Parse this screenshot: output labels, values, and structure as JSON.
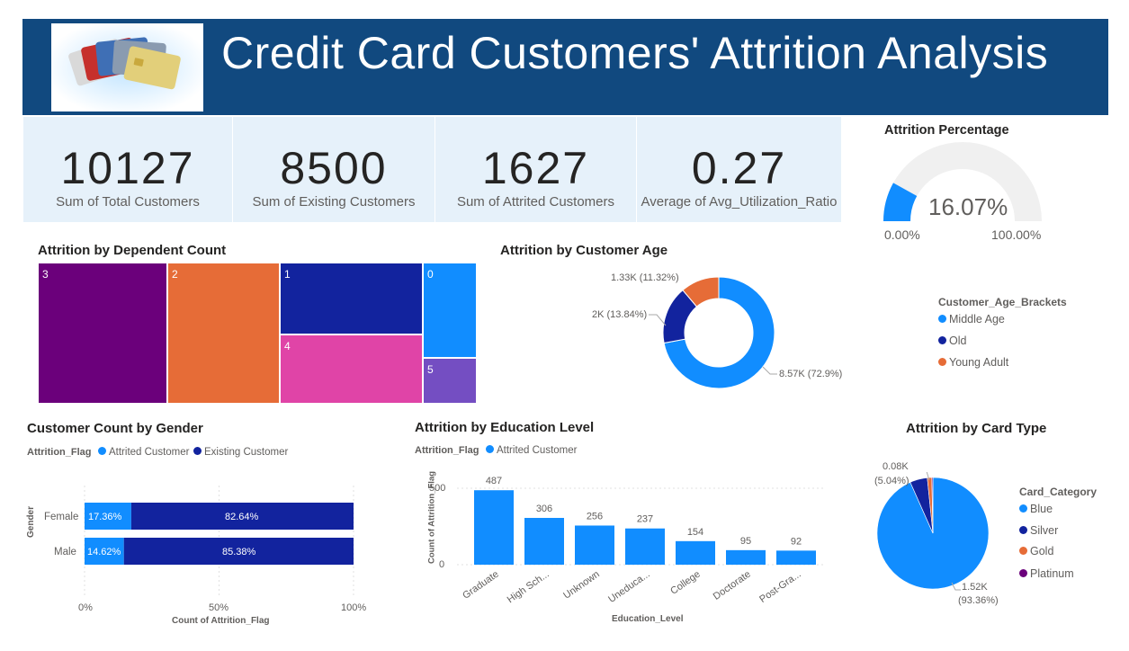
{
  "header": {
    "title": "Credit Card Customers' Attrition Analysis"
  },
  "kpis": [
    {
      "value": "10127",
      "label": "Sum of Total Customers"
    },
    {
      "value": "8500",
      "label": "Sum of Existing Customers"
    },
    {
      "value": "1627",
      "label": "Sum of Attrited Customers"
    },
    {
      "value": "0.27",
      "label": "Average of Avg_Utilization_Ratio"
    }
  ],
  "gauge": {
    "title": "Attrition Percentage",
    "value_label": "16.07%",
    "value": 16.07,
    "min_label": "0.00%",
    "max_label": "100.00%",
    "min": 0,
    "max": 100,
    "fill_color": "#118dff",
    "track_color": "#f0f0f0"
  },
  "treemap": {
    "title": "Attrition by Dependent Count",
    "items": [
      {
        "label": "3",
        "color": "#6b007b"
      },
      {
        "label": "2",
        "color": "#e66c37"
      },
      {
        "label": "1",
        "color": "#12239e"
      },
      {
        "label": "4",
        "color": "#e044a7"
      },
      {
        "label": "0",
        "color": "#118dff"
      },
      {
        "label": "5",
        "color": "#744ec2"
      }
    ]
  },
  "donut": {
    "title": "Attrition by Customer Age",
    "legend_title": "Customer_Age_Brackets",
    "labels": [
      "1.33K (11.32%)",
      "2K (13.84%)",
      "8.57K (72.9%)"
    ],
    "legend": [
      "Middle Age",
      "Old",
      "Young Adult"
    ],
    "colors": [
      "#118dff",
      "#12239e",
      "#e66c37"
    ]
  },
  "gender": {
    "title": "Customer Count by Gender",
    "legend_title": "Attrition_Flag",
    "legend": [
      "Attrited Customer",
      "Existing Customer"
    ],
    "colors": [
      "#118dff",
      "#12239e"
    ],
    "categories": [
      "Female",
      "Male"
    ],
    "attrited_labels": [
      "17.36%",
      "14.62%"
    ],
    "existing_labels": [
      "82.64%",
      "85.38%"
    ],
    "ylabel": "Gender",
    "xlabel": "Count of Attrition_Flag",
    "xticks": [
      "0%",
      "50%",
      "100%"
    ]
  },
  "education": {
    "title": "Attrition by Education Level",
    "legend_title": "Attrition_Flag",
    "legend": [
      "Attrited Customer"
    ],
    "ylabel": "Count of Attrition_Flag",
    "xlabel": "Education_Level",
    "yticks": [
      "500",
      "0"
    ],
    "categories": [
      "Graduate",
      "High Sch...",
      "Unknown",
      "Uneduca...",
      "College",
      "Doctorate",
      "Post-Gra..."
    ],
    "value_labels": [
      "487",
      "306",
      "256",
      "237",
      "154",
      "95",
      "92"
    ]
  },
  "cardtype": {
    "title": "Attrition by Card Type",
    "legend_title": "Card_Category",
    "legend": [
      "Blue",
      "Silver",
      "Gold",
      "Platinum"
    ],
    "colors": [
      "#118dff",
      "#12239e",
      "#e66c37",
      "#6b007b"
    ],
    "small_label_1": "0.08K",
    "small_label_2": "(5.04%)",
    "big_label_1": "1.52K",
    "big_label_2": "(93.36%)"
  },
  "chart_data": [
    {
      "type": "treemap",
      "title": "Attrition by Dependent Count",
      "categories": [
        "3",
        "2",
        "1",
        "4",
        "0",
        "5"
      ],
      "values": [
        482,
        417,
        269,
        260,
        135,
        64
      ]
    },
    {
      "type": "pie",
      "title": "Attrition by Customer Age",
      "categories": [
        "Middle Age",
        "Old",
        "Young Adult"
      ],
      "values": [
        8570,
        2000,
        1330
      ],
      "percent_labels": [
        "72.9%",
        "13.84%",
        "11.32%"
      ]
    },
    {
      "type": "bar",
      "title": "Customer Count by Gender",
      "orientation": "horizontal",
      "stacked_100": true,
      "categories": [
        "Female",
        "Male"
      ],
      "series": [
        {
          "name": "Attrited Customer",
          "values": [
            17.36,
            14.62
          ]
        },
        {
          "name": "Existing Customer",
          "values": [
            82.64,
            85.38
          ]
        }
      ],
      "xlabel": "Count of Attrition_Flag",
      "ylabel": "Gender",
      "xlim": [
        0,
        100
      ]
    },
    {
      "type": "bar",
      "title": "Attrition by Education Level",
      "categories": [
        "Graduate",
        "High Sch...",
        "Unknown",
        "Uneduca...",
        "College",
        "Doctorate",
        "Post-Gra..."
      ],
      "series": [
        {
          "name": "Attrited Customer",
          "values": [
            487,
            306,
            256,
            237,
            154,
            95,
            92
          ]
        }
      ],
      "xlabel": "Education_Level",
      "ylabel": "Count of Attrition_Flag",
      "ylim": [
        0,
        550
      ]
    },
    {
      "type": "pie",
      "title": "Attrition by Card Type",
      "categories": [
        "Blue",
        "Silver",
        "Gold",
        "Platinum"
      ],
      "values": [
        93.36,
        5.04,
        1.3,
        0.3
      ]
    }
  ]
}
